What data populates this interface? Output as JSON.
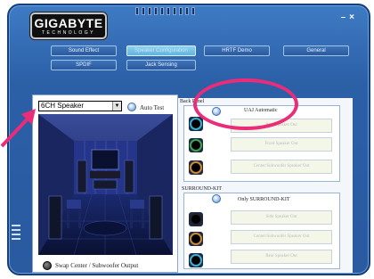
{
  "app": {
    "brand_main": "GIGABYTE",
    "brand_sub": "TECHNOLOGY",
    "minimize": "–",
    "close": "×"
  },
  "nav": {
    "row1": [
      "Sound Effect",
      "Speaker Configuration",
      "HRTF Demo",
      "General"
    ],
    "row2": [
      "SPDIF",
      "Jack Sensing"
    ],
    "active": "Speaker Configuration"
  },
  "left": {
    "speaker_mode": "6CH Speaker",
    "auto_test": "Auto Test",
    "swap_output": "Swap Center / Subwoofer Output"
  },
  "back_panel": {
    "title": "Back Panel",
    "uaj_label": "UAJ Automatic",
    "outputs": [
      "Rear Speaker Out",
      "Front Speaker Out",
      "Center/Subwoofer Speaker Out"
    ]
  },
  "surround_kit": {
    "title": "SURROUND-KIT",
    "only_label": "Only SURROUND-KIT",
    "outputs": [
      "Side Speaker Out",
      "Center/Subwoofer Speaker Out",
      "Rear Speaker Out"
    ]
  },
  "colors": {
    "frame": "#2b5fa6",
    "highlight": "#ea2c79",
    "jack_blue": "#3ab0d0",
    "jack_green": "#40a64a",
    "jack_orange": "#d08a2a"
  },
  "icons": {
    "auto_test_radio": "radio-icon",
    "uaj_radio": "radio-icon",
    "grip": "grip-icon"
  }
}
